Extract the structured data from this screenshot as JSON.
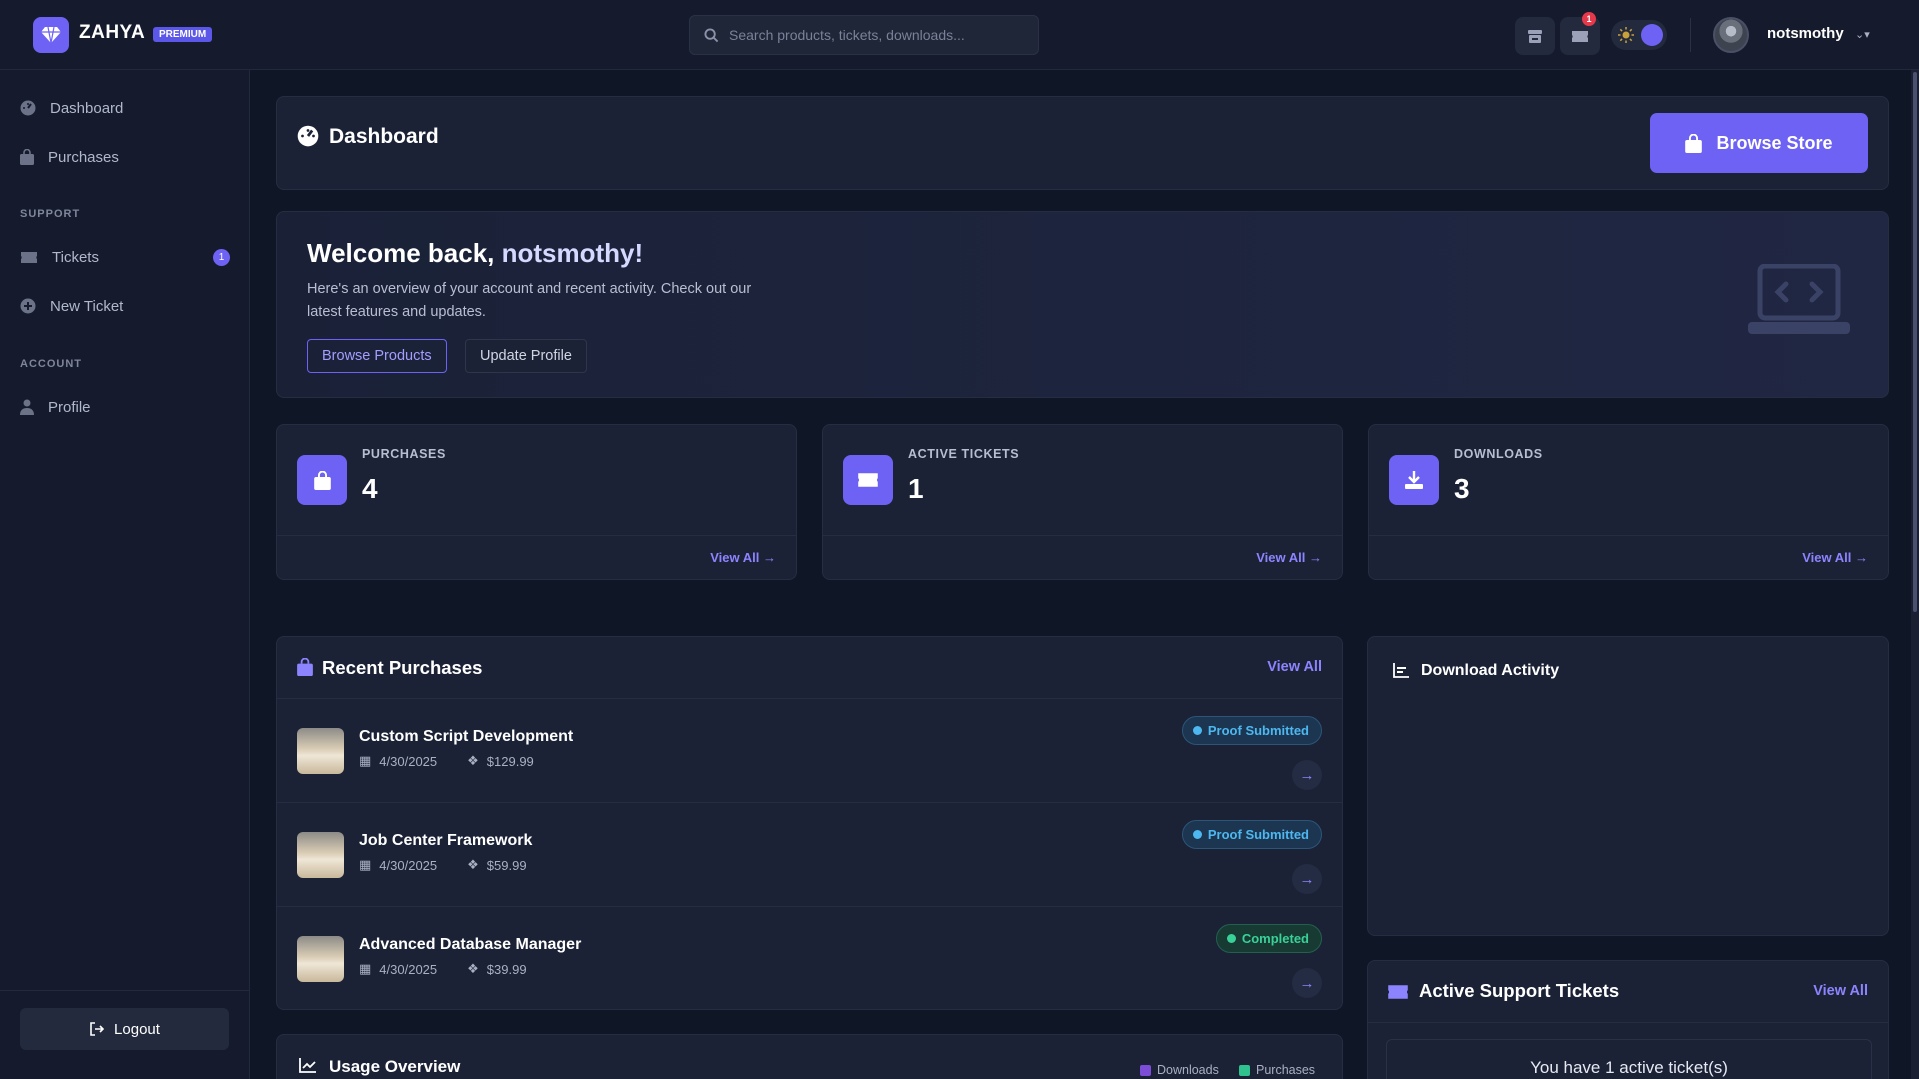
{
  "brand": {
    "name": "ZAHYA",
    "badge": "PREMIUM"
  },
  "search": {
    "placeholder": "Search products, tickets, downloads..."
  },
  "header": {
    "notification_count": "1",
    "username": "notsmothy"
  },
  "sidebar": {
    "items": [
      {
        "label": "Dashboard",
        "icon": "dashboard-icon"
      },
      {
        "label": "Purchases",
        "icon": "bag-icon"
      }
    ],
    "support_section": "SUPPORT",
    "support_items": [
      {
        "label": "Tickets",
        "icon": "ticket-icon",
        "badge": "1"
      },
      {
        "label": "New Ticket",
        "icon": "plus-circle-icon"
      }
    ],
    "account_section": "ACCOUNT",
    "account_items": [
      {
        "label": "Profile",
        "icon": "user-icon"
      }
    ],
    "logout_label": "Logout"
  },
  "page": {
    "title": "Dashboard",
    "browse_store": "Browse Store"
  },
  "welcome": {
    "greeting": "Welcome back, ",
    "name": "notsmothy!",
    "text": "Here's an overview of your account and recent activity. Check out our latest features and updates.",
    "browse_products": "Browse Products",
    "update_profile": "Update Profile"
  },
  "stats": [
    {
      "label": "PURCHASES",
      "value": "4",
      "link": "View All"
    },
    {
      "label": "ACTIVE TICKETS",
      "value": "1",
      "link": "View All"
    },
    {
      "label": "DOWNLOADS",
      "value": "3",
      "link": "View All"
    }
  ],
  "recent_purchases": {
    "title": "Recent Purchases",
    "link": "View All",
    "items": [
      {
        "name": "Custom Script Development",
        "date": "4/30/2025",
        "price": "$129.99",
        "status": "Proof Submitted",
        "status_type": "proof"
      },
      {
        "name": "Job Center Framework",
        "date": "4/30/2025",
        "price": "$59.99",
        "status": "Proof Submitted",
        "status_type": "proof"
      },
      {
        "name": "Advanced Database Manager",
        "date": "4/30/2025",
        "price": "$39.99",
        "status": "Completed",
        "status_type": "done"
      }
    ]
  },
  "download_activity": {
    "title": "Download Activity"
  },
  "support_tickets": {
    "title": "Active Support Tickets",
    "link": "View All",
    "message": "You have 1 active ticket(s)"
  },
  "usage": {
    "title": "Usage Overview",
    "legend": [
      {
        "label": "Downloads",
        "color": "#7c4dd6"
      },
      {
        "label": "Purchases",
        "color": "#2fc28f"
      }
    ]
  },
  "colors": {
    "accent": "#6d62f3",
    "bg": "#0f1626",
    "card": "#1b2236"
  }
}
